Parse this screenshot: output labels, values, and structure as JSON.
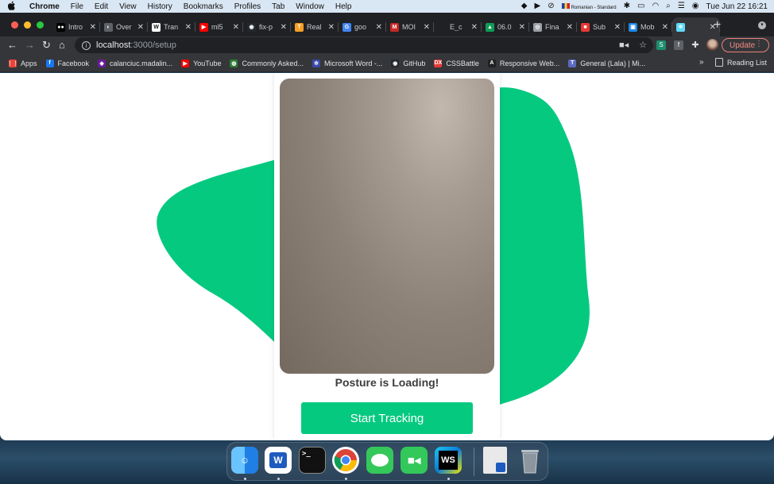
{
  "menubar": {
    "apple": "",
    "items": [
      "Chrome",
      "File",
      "Edit",
      "View",
      "History",
      "Bookmarks",
      "Profiles",
      "Tab",
      "Window",
      "Help"
    ],
    "input_source": "Romanian - Standard",
    "datetime": "Tue Jun 22  16:21"
  },
  "tabs": [
    {
      "label": "Intro",
      "fav_color": "#000000",
      "fav": "●●"
    },
    {
      "label": "Over",
      "fav_color": "#5f6368",
      "fav": "◐"
    },
    {
      "label": "Tran",
      "fav_color": "#ffffff",
      "fav": "W"
    },
    {
      "label": "ml5",
      "fav_color": "#ff0000",
      "fav": "▶"
    },
    {
      "label": "fix-p",
      "fav_color": "#24292e",
      "fav": "◉"
    },
    {
      "label": "Real",
      "fav_color": "#f4a025",
      "fav": "T"
    },
    {
      "label": "goo",
      "fav_color": "#4285f4",
      "fav": "G"
    },
    {
      "label": "MOI",
      "fav_color": "#c62828",
      "fav": "M"
    },
    {
      "label": "E_c",
      "fav_color": "#202124",
      "fav": ""
    },
    {
      "label": "06.0",
      "fav_color": "#0f9d58",
      "fav": "▲"
    },
    {
      "label": "Fina",
      "fav_color": "#9aa0a6",
      "fav": "◎"
    },
    {
      "label": "Sub",
      "fav_color": "#e53935",
      "fav": "■"
    },
    {
      "label": "Mob",
      "fav_color": "#1e88e5",
      "fav": "▣"
    },
    {
      "label": "",
      "fav_color": "#61dafb",
      "fav": "⚛",
      "active": true
    }
  ],
  "toolbar": {
    "url_host": "localhost",
    "url_path": ":3000/setup",
    "update_label": "Update"
  },
  "bookmarks": [
    {
      "label": "Apps",
      "icon_color": "#e8453c",
      "icon": "⋮⋮"
    },
    {
      "label": "Facebook",
      "icon_color": "#1877f2",
      "icon": "f"
    },
    {
      "label": "calanciuc.madalin...",
      "icon_color": "#6a1b9a",
      "icon": "◆"
    },
    {
      "label": "YouTube",
      "icon_color": "#ff0000",
      "icon": "▶"
    },
    {
      "label": "Commonly Asked...",
      "icon_color": "#2e7d32",
      "icon": "◍"
    },
    {
      "label": "Microsoft Word -...",
      "icon_color": "#3949ab",
      "icon": "✲"
    },
    {
      "label": "GitHub",
      "icon_color": "#24292e",
      "icon": "◉"
    },
    {
      "label": "CSSBattle",
      "icon_color": "#e53935",
      "icon": "DX"
    },
    {
      "label": "Responsive Web...",
      "icon_color": "#212121",
      "icon": "A"
    },
    {
      "label": "General (Lala) | Mi...",
      "icon_color": "#5c6bc0",
      "icon": "T"
    }
  ],
  "bookmarks_more": "»",
  "reading_list": "Reading List",
  "page": {
    "status_text": "Posture is Loading!",
    "start_button": "Start Tracking",
    "accent_color": "#06c980"
  },
  "dock": [
    {
      "name": "finder",
      "color": "#2a8cf0"
    },
    {
      "name": "word",
      "color": "#1f5bbf",
      "label": "W"
    },
    {
      "name": "terminal",
      "color": "#111111",
      "label": ">_"
    },
    {
      "name": "chrome",
      "color": "#ffffff"
    },
    {
      "name": "messages",
      "color": "#34c759"
    },
    {
      "name": "facetime",
      "color": "#32c85a"
    },
    {
      "name": "webstorm",
      "color": "#0a7bd6",
      "label": "WS"
    },
    {
      "name": "document-preview",
      "color": "#e9e9e9"
    },
    {
      "name": "trash",
      "color": "#9aa3ab"
    }
  ]
}
